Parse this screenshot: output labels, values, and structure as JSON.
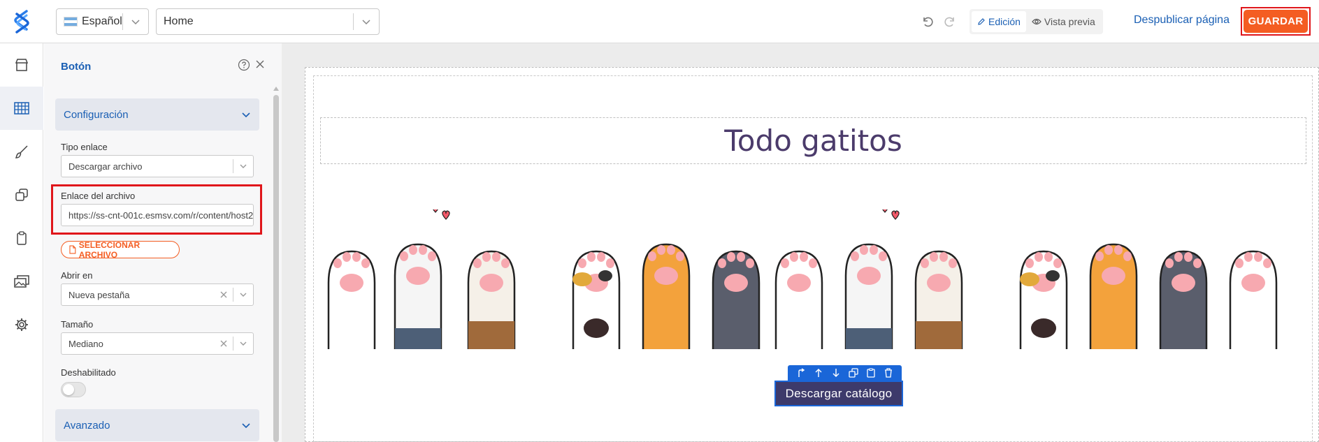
{
  "topbar": {
    "language": "Español",
    "page": "Home",
    "mode_edit": "Edición",
    "mode_preview": "Vista previa",
    "unpublish": "Despublicar página",
    "save": "GUARDAR"
  },
  "rail": [
    "store-icon",
    "grid-icon",
    "brush-icon",
    "copy-icon",
    "clipboard-icon",
    "images-icon",
    "gear-icon"
  ],
  "panel": {
    "title": "Botón",
    "section_config": "Configuración",
    "link_type_label": "Tipo enlace",
    "link_type_value": "Descargar archivo",
    "file_link_label": "Enlace del archivo",
    "file_link_value": "https://ss-cnt-001c.esmsv.com/r/content/host2",
    "select_file": "SELECCIONAR ARCHIVO",
    "open_in_label": "Abrir en",
    "open_in_value": "Nueva pestaña",
    "size_label": "Tamaño",
    "size_value": "Mediano",
    "disabled_label": "Deshabilitado",
    "section_advanced": "Avanzado"
  },
  "canvas": {
    "title": "Todo gatitos",
    "button_label": "Descargar catálogo"
  },
  "colors": {
    "brand_blue": "#1a5fb4",
    "save_orange": "#f45d22",
    "highlight_red": "#e0161b",
    "button_purple": "#3d3a6b"
  }
}
